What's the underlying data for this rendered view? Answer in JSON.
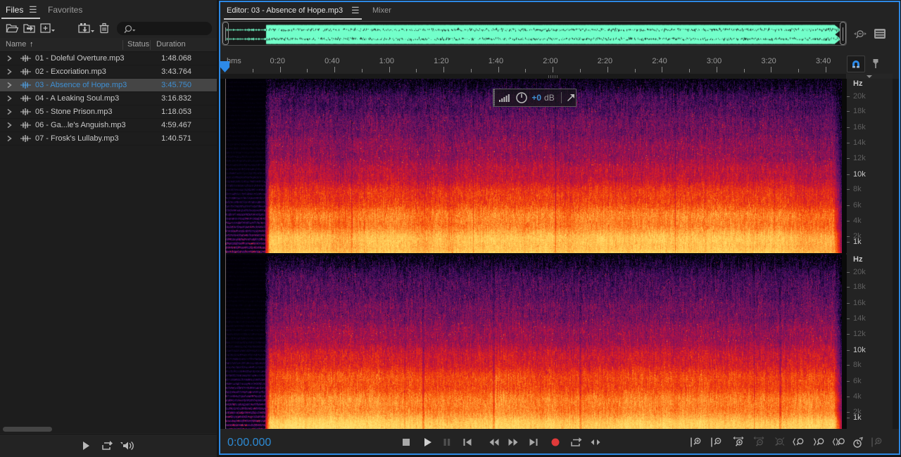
{
  "files_panel": {
    "tabs": [
      {
        "label": "Files",
        "active": true
      },
      {
        "label": "Favorites",
        "active": false
      }
    ],
    "toolbar_icons": [
      "open-folder",
      "import-folder",
      "new-item",
      "media-import",
      "trash",
      "search"
    ],
    "search_value": "",
    "columns": {
      "name": "Name",
      "status": "Status",
      "duration": "Duration"
    },
    "sort_column": "Name",
    "files": [
      {
        "name": "01 - Doleful Overture.mp3",
        "status": "",
        "duration": "1:48.068",
        "selected": false
      },
      {
        "name": "02 - Excoriation.mp3",
        "status": "",
        "duration": "3:43.764",
        "selected": false
      },
      {
        "name": "03 - Absence of Hope.mp3",
        "status": "",
        "duration": "3:45.750",
        "selected": true
      },
      {
        "name": "04 - A Leaking Soul.mp3",
        "status": "",
        "duration": "3:16.832",
        "selected": false
      },
      {
        "name": "05 - Stone Prison.mp3",
        "status": "",
        "duration": "1:18.053",
        "selected": false
      },
      {
        "name": "06 - Ga...le's Anguish.mp3",
        "status": "",
        "duration": "4:59.467",
        "selected": false
      },
      {
        "name": "07 - Frosk's Lullaby.mp3",
        "status": "",
        "duration": "1:40.571",
        "selected": false
      }
    ],
    "bottom_icons": [
      "play",
      "loop-playback",
      "auto-play"
    ]
  },
  "editor": {
    "tabs": [
      {
        "label": "Editor: 03 - Absence of Hope.mp3",
        "active": true
      },
      {
        "label": "Mixer",
        "active": false
      }
    ],
    "overview_icons": [
      "zoom-navigator",
      "panel-list"
    ],
    "ruler": {
      "unit_label": "hms",
      "tick_labels": [
        "0:20",
        "0:40",
        "1:00",
        "1:20",
        "1:40",
        "2:00",
        "2:20",
        "2:40",
        "3:00",
        "3:20",
        "3:40"
      ],
      "snap_enabled": true
    },
    "hud": {
      "gain": "+0",
      "unit": "dB"
    },
    "frequency_scale": {
      "unit": "Hz",
      "labels": [
        "20k",
        "18k",
        "16k",
        "14k",
        "12k",
        "10k",
        "8k",
        "6k",
        "4k",
        "2k",
        "1k"
      ],
      "bright_labels": [
        "10k",
        "1k"
      ]
    },
    "transport": {
      "time": "0:00.000",
      "buttons": [
        {
          "name": "stop",
          "disabled": false
        },
        {
          "name": "play",
          "disabled": false
        },
        {
          "name": "pause",
          "disabled": true
        },
        {
          "name": "skip-to-start",
          "disabled": false
        },
        {
          "name": "rewind",
          "disabled": false
        },
        {
          "name": "fast-forward",
          "disabled": false
        },
        {
          "name": "skip-to-end",
          "disabled": false
        },
        {
          "name": "record",
          "disabled": false
        },
        {
          "name": "loop-playback",
          "disabled": false
        },
        {
          "name": "skip-playhead",
          "disabled": false
        }
      ]
    },
    "zoom_toolbar": [
      {
        "name": "zoom-in-amplitude",
        "disabled": false
      },
      {
        "name": "zoom-out-amplitude",
        "disabled": false
      },
      {
        "name": "zoom-in-time",
        "disabled": false
      },
      {
        "name": "zoom-out-time",
        "disabled": true
      },
      {
        "name": "zoom-out-full",
        "disabled": true
      },
      {
        "name": "zoom-in-left-edge",
        "disabled": false
      },
      {
        "name": "zoom-in-right-edge",
        "disabled": false
      },
      {
        "name": "zoom-to-selection",
        "disabled": false
      },
      {
        "name": "timer",
        "disabled": false
      },
      {
        "name": "zoom-vertical-selection",
        "disabled": true
      }
    ]
  },
  "spectrogram": {
    "channels": 2,
    "intro_silence_frac": 0.065,
    "waveform_color": "#73ffca",
    "palette": [
      "#000004",
      "#10062a",
      "#2d0a51",
      "#4b0e5e",
      "#6b155f",
      "#8d1257",
      "#b01346",
      "#d21a2c",
      "#ea3311",
      "#f95d0d",
      "#fe8c2e",
      "#ffb94a",
      "#ffd863",
      "#ffe87e"
    ]
  },
  "colors": {
    "accent_blue": "#2d89e5",
    "selection_text": "#3f8fd2",
    "time_display": "#2d8bd5",
    "record_red": "#e03a3a"
  }
}
